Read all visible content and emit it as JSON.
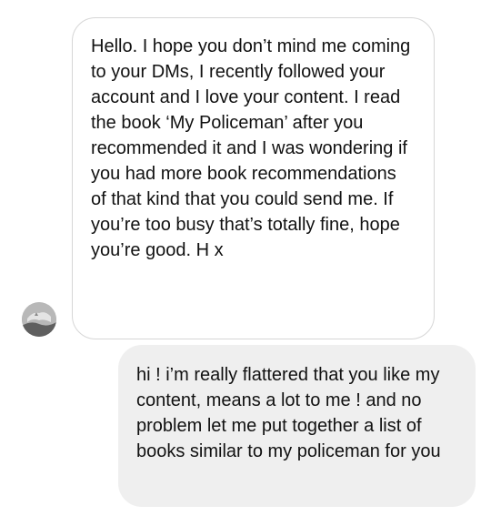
{
  "conversation": {
    "received_message": {
      "text": "Hello. I hope you don’t mind me coming to your DMs, I recently followed your account and I love your content. I read the book ‘My Policeman’ after you recommended it and I was wondering if you had more book recommendations of that kind that you could send me. If you’re too busy that’s totally fine, hope you’re good. H x"
    },
    "sent_message": {
      "text": "hi ! i’m really flattered that you like my content, means a lot to me ! and no problem let me put together a list of books similar to my policeman for you"
    },
    "avatar": {
      "icon": "profile-photo"
    }
  }
}
